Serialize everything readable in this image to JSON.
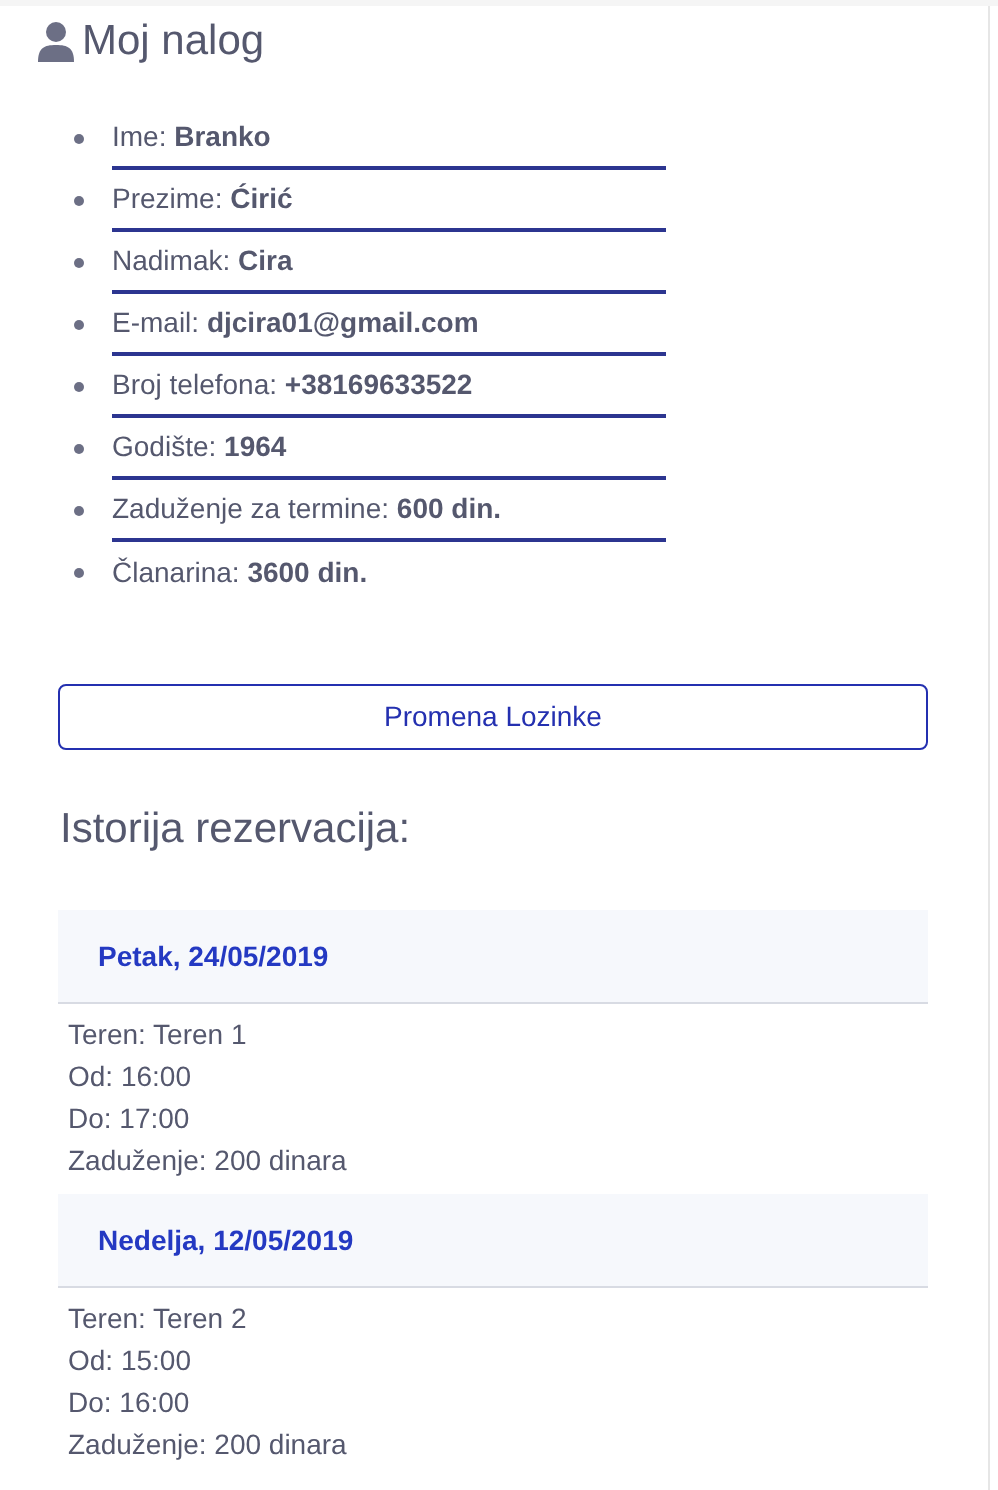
{
  "page_title": "Moj nalog",
  "profile_items": [
    {
      "text": "Ime: **Branko**"
    },
    {
      "text": "Prezime: **Ćirić**"
    },
    {
      "text": "Nadimak: **Cira**"
    },
    {
      "text": "E-mail: **djcira01@gmail.com**"
    },
    {
      "text": "Broj telefona: **+38169633522**"
    },
    {
      "text": "Godište: **1964**"
    },
    {
      "text": "Zaduženje za termine: **600 din.**"
    },
    {
      "text": "Članarina: **3600 din.**"
    }
  ],
  "change_password_button": "Promena Lozinke",
  "history_heading": "Istorija rezervacija:",
  "reservations": [
    {
      "date": "Petak, 24/05/2019",
      "lines": [
        "Teren: Teren 1",
        "Od: 16:00",
        "Do: 17:00",
        "Zaduženje: 200 dinara"
      ]
    },
    {
      "date": "Nedelja, 12/05/2019",
      "lines": [
        "Teren: Teren 2",
        "Od: 15:00",
        "Do: 16:00",
        "Zaduženje: 200 dinara"
      ]
    }
  ]
}
